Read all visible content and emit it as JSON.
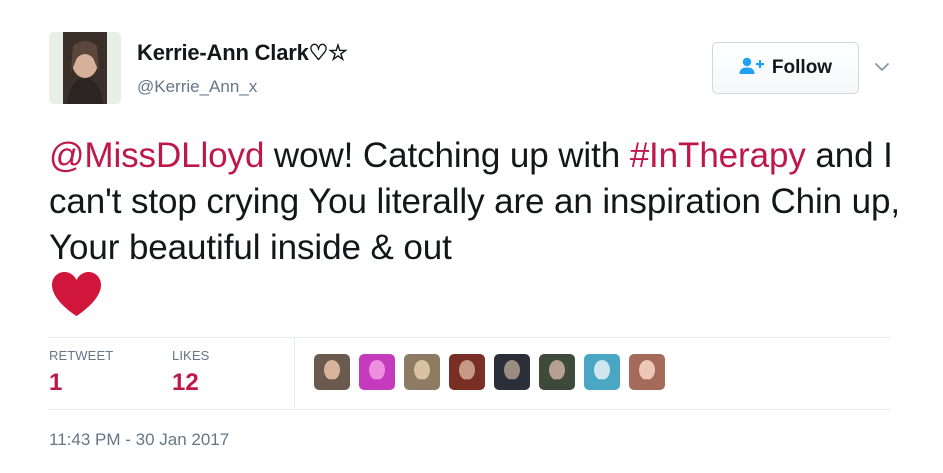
{
  "author": {
    "name": "Kerrie-Ann Clark♡☆",
    "handle": "@Kerrie_Ann_x"
  },
  "follow_button": {
    "label": "Follow",
    "icon": "follow-person-plus-icon"
  },
  "caret_icon": "chevron-down-icon",
  "tweet": {
    "mention": "@MissDLloyd",
    "text_1": " wow! Catching up with ",
    "hashtag": "#InTherapy",
    "text_2": " and I can't stop crying You literally are an inspiration Chin up, Your beautiful inside & out",
    "emoji": "red-heart-icon"
  },
  "stats": {
    "retweet_label": "RETWEET",
    "retweet_count": "1",
    "likes_label": "LIKES",
    "likes_count": "12"
  },
  "likers": [
    {
      "name": "liker-avatar-1",
      "colors": [
        "#6b5a4e",
        "#d8b49a"
      ]
    },
    {
      "name": "liker-avatar-2",
      "colors": [
        "#c43cbd",
        "#ee8fe0"
      ]
    },
    {
      "name": "liker-avatar-3",
      "colors": [
        "#8d7c63",
        "#d9c2a2"
      ]
    },
    {
      "name": "liker-avatar-4",
      "colors": [
        "#7a2f26",
        "#c79a85"
      ]
    },
    {
      "name": "liker-avatar-5",
      "colors": [
        "#2a2f3a",
        "#9a8c80"
      ]
    },
    {
      "name": "liker-avatar-6",
      "colors": [
        "#3e4a3a",
        "#b8a090"
      ]
    },
    {
      "name": "liker-avatar-7",
      "colors": [
        "#4aa7c4",
        "#cfe6ee"
      ]
    },
    {
      "name": "liker-avatar-8",
      "colors": [
        "#a46a5a",
        "#ecc7b8"
      ]
    }
  ],
  "timestamp": "11:43 PM - 30 Jan 2017",
  "colors": {
    "accent": "#c0174b",
    "secondary_text": "#657786",
    "heart": "#d0173b"
  }
}
